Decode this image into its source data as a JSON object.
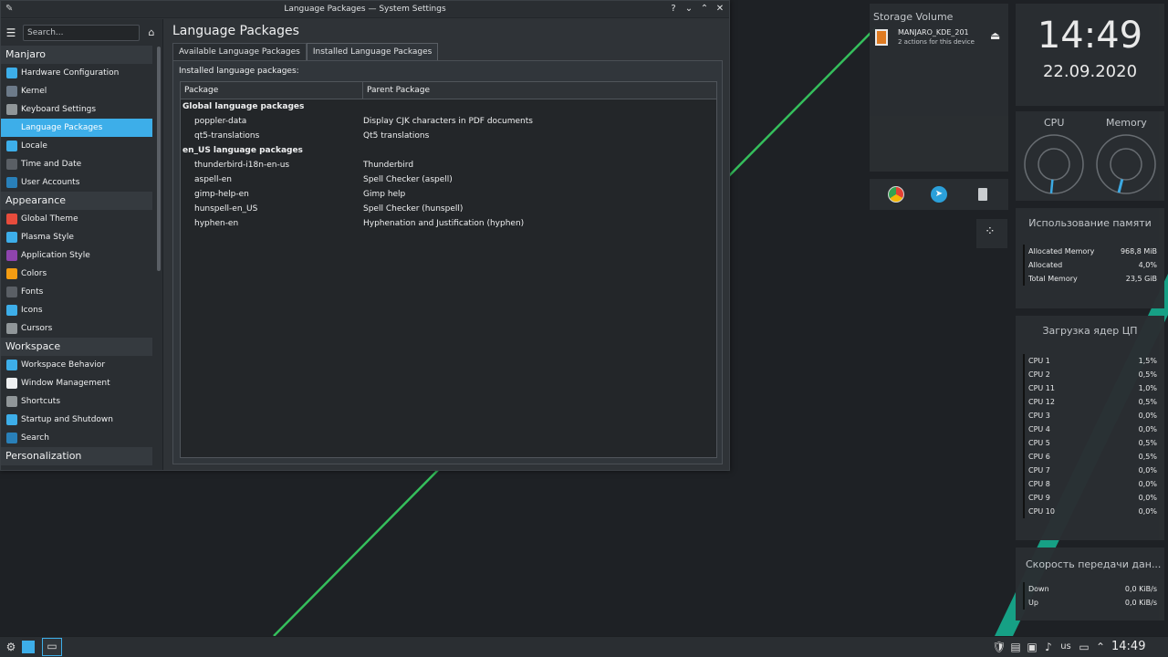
{
  "window": {
    "title": "Language Packages — System Settings",
    "buttons": [
      "?",
      "⌄",
      "⌃",
      "✕"
    ]
  },
  "sidebar": {
    "search_placeholder": "Search...",
    "categories": [
      {
        "label": "Manjaro",
        "items": [
          {
            "label": "Hardware Configuration",
            "color": "#3daee9"
          },
          {
            "label": "Kernel",
            "color": "#6c7a89"
          },
          {
            "label": "Keyboard Settings",
            "color": "#909699"
          },
          {
            "label": "Language Packages",
            "color": "#3daee9",
            "selected": true
          },
          {
            "label": "Locale",
            "color": "#3daee9"
          },
          {
            "label": "Time and Date",
            "color": "#5a5f65"
          },
          {
            "label": "User Accounts",
            "color": "#2980b9"
          }
        ]
      },
      {
        "label": "Appearance",
        "items": [
          {
            "label": "Global Theme",
            "color": "#e74c3c"
          },
          {
            "label": "Plasma Style",
            "color": "#3daee9"
          },
          {
            "label": "Application Style",
            "color": "#8e44ad"
          },
          {
            "label": "Colors",
            "color": "#f39c12"
          },
          {
            "label": "Fonts",
            "color": "#5a5f65"
          },
          {
            "label": "Icons",
            "color": "#3daee9"
          },
          {
            "label": "Cursors",
            "color": "#909699"
          }
        ]
      },
      {
        "label": "Workspace",
        "items": [
          {
            "label": "Workspace Behavior",
            "color": "#3daee9"
          },
          {
            "label": "Window Management",
            "color": "#eff0f1"
          },
          {
            "label": "Shortcuts",
            "color": "#909699"
          },
          {
            "label": "Startup and Shutdown",
            "color": "#3daee9"
          },
          {
            "label": "Search",
            "color": "#2980b9"
          }
        ]
      },
      {
        "label": "Personalization",
        "items": []
      }
    ]
  },
  "content": {
    "title": "Language Packages",
    "tabs": [
      {
        "label": "Available Language Packages",
        "active": false
      },
      {
        "label": "Installed Language Packages",
        "active": true
      }
    ],
    "installed_label": "Installed language packages:",
    "columns": [
      "Package",
      "Parent Package"
    ],
    "rows": [
      {
        "package": "Global language packages",
        "parent": "",
        "group": true
      },
      {
        "package": "poppler-data",
        "parent": "Display CJK characters in PDF documents"
      },
      {
        "package": "qt5-translations",
        "parent": "Qt5 translations"
      },
      {
        "package": "en_US language packages",
        "parent": "",
        "group": true
      },
      {
        "package": "thunderbird-i18n-en-us",
        "parent": "Thunderbird"
      },
      {
        "package": "aspell-en",
        "parent": "Spell Checker (aspell)"
      },
      {
        "package": "gimp-help-en",
        "parent": "Gimp help"
      },
      {
        "package": "hunspell-en_US",
        "parent": "Spell Checker (hunspell)"
      },
      {
        "package": "hyphen-en",
        "parent": "Hyphenation and Justification (hyphen)"
      }
    ]
  },
  "storage": {
    "title": "Storage Volume",
    "device": "MANJARO_KDE_201",
    "actions": "2 actions for this device"
  },
  "clock": {
    "time": "14:49",
    "date": "22.09.2020"
  },
  "gauges": {
    "cpu_label": "CPU",
    "memory_label": "Memory",
    "cpu_level": 0.015,
    "memory_level": 0.04
  },
  "memory": {
    "title": "Использование памяти",
    "rows": [
      {
        "k": "Allocated Memory",
        "v": "968,8 MiB"
      },
      {
        "k": "Allocated",
        "v": "4,0%"
      },
      {
        "k": "Total Memory",
        "v": "23,5 GiB"
      }
    ]
  },
  "cpu_load": {
    "title": "Загрузка ядер ЦП",
    "rows": [
      {
        "k": "CPU 1",
        "v": "1,5%"
      },
      {
        "k": "CPU 2",
        "v": "0,5%"
      },
      {
        "k": "CPU 11",
        "v": "1,0%"
      },
      {
        "k": "CPU 12",
        "v": "0,5%"
      },
      {
        "k": "CPU 3",
        "v": "0,0%"
      },
      {
        "k": "CPU 4",
        "v": "0,0%"
      },
      {
        "k": "CPU 5",
        "v": "0,5%"
      },
      {
        "k": "CPU 6",
        "v": "0,5%"
      },
      {
        "k": "CPU 7",
        "v": "0,0%"
      },
      {
        "k": "CPU 8",
        "v": "0,0%"
      },
      {
        "k": "CPU 9",
        "v": "0,0%"
      },
      {
        "k": "CPU 10",
        "v": "0,0%"
      }
    ]
  },
  "network": {
    "title": "Скорость передачи дан...",
    "rows": [
      {
        "k": "Down",
        "v": "0,0 KiB/s"
      },
      {
        "k": "Up",
        "v": "0,0 KiB/s"
      }
    ]
  },
  "taskbar": {
    "keyboard_layout": "us",
    "time": "14:49"
  },
  "colors": {
    "accent": "#3daee9",
    "manjaro_green": "#35bf5c",
    "teal": "#16a085"
  }
}
